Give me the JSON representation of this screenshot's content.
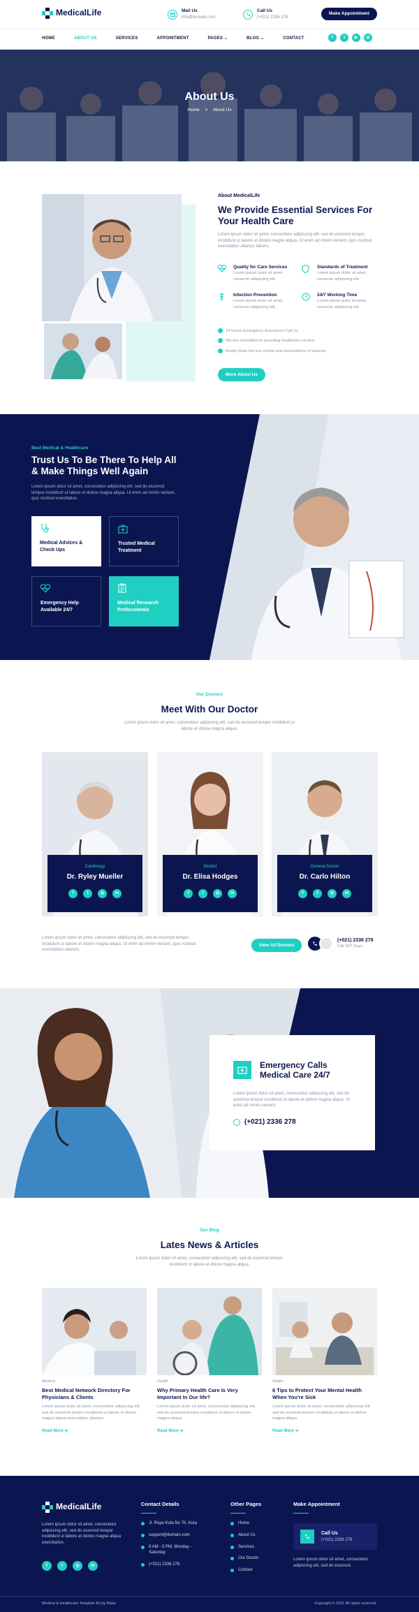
{
  "brand": {
    "name": "MedicalLife",
    "teal": "#1fcfc1",
    "navy": "#0b1650"
  },
  "header": {
    "mail_label": "Mail Us",
    "mail_value": "info@domain.com",
    "call_label": "Call Us",
    "call_value": "(+021) 2336 278",
    "cta": "Make Appointment",
    "nav": [
      "HOME",
      "ABOUT US",
      "SERVICES",
      "APPOINTMENT",
      "PAGES",
      "BLOG",
      "CONTACT"
    ],
    "social_icons": [
      "facebook-icon",
      "twitter-icon",
      "youtube-icon",
      "instagram-icon"
    ]
  },
  "hero": {
    "title": "About Us",
    "crumb_home": "Home",
    "crumb_sep": ">",
    "crumb_current": "About Us"
  },
  "about": {
    "eyebrow": "About MedicalLife",
    "title": "We Provide Essential Services For Your Health Care",
    "text": "Lorem ipsum dolor sit amet, consectetur adipiscing elit, sed do eiusmod tempor incididunt ut labore et dolore magna aliqua. Ut enim ad minim veniam, quis nostrud exercitation ullamco laboris.",
    "features": [
      {
        "title": "Quality for Care Services",
        "text": "Lorem ipsum dolor sit amet, consecte adipiscing elit."
      },
      {
        "title": "Standards of Treatment",
        "text": "Lorem ipsum dolor sit amet, consecte adipiscing elit."
      },
      {
        "title": "Infection Prevention",
        "text": "Lorem ipsum dolor sit amet, consecte adipiscing elit."
      },
      {
        "title": "24/7 Working Time",
        "text": "Lorem ipsum dolor sit amet, consecte adipiscing elit."
      }
    ],
    "checks": [
      "24 Hours Emergency Assistance Call Us",
      "We are committed to providing healthcare service",
      "Really know the true needs and expectations of patients"
    ],
    "cta": "More About Us"
  },
  "trust": {
    "eyebrow": "Best Medical & Healthcare",
    "title": "Trust Us To Be There To Help All & Make Things Well Again",
    "text": "Lorem ipsum dolor sit amet, consectetur adipiscing elit, sed do eiusmod tempor incididunt ut labore et dolore magna aliqua. Ut enim ad minim veniam, quis nostrud exercitation.",
    "services": [
      "Medical Advices & Check Ups",
      "Trusted Medical Treatment",
      "Emergency Help Available 24/7",
      "Medical Research Professionals"
    ]
  },
  "doctors": {
    "eyebrow": "Our Doctors",
    "title": "Meet With Our Doctor",
    "text": "Lorem ipsum dolor sit amet, consectetur adipiscing elit, sed do eiusmod tempor incididunt ut labore et dolore magna aliqua.",
    "list": [
      {
        "role": "Cardiology",
        "name": "Dr. Ryley Mueller"
      },
      {
        "role": "Dentist",
        "name": "Dr. Elisa Hodges"
      },
      {
        "role": "General Doctor",
        "name": "Dr. Carlo Hilton"
      }
    ],
    "bottom_text": "Lorem ipsum dolor sit amet, consectetur adipiscing elit, sed do eiusmod tempor incididunt ut labore et dolore magna aliqua. Ut enim ad minim veniam, quis nostrud exercitation ullamco.",
    "cta": "View All Doctors",
    "phone": "(+021) 2336 278",
    "phone_note": "Call 24/7 Days"
  },
  "emergency": {
    "title": "Emergency Calls Medical Care 24/7",
    "text": "Lorem ipsum dolor sit amet, consectetur adipiscing elit, sed do eiusmod tempor incididunt ut labore et dolore magna aliqua. Ut enim ad minim veniam.",
    "phone": "(+021) 2336 278"
  },
  "blog": {
    "eyebrow": "Our Blog",
    "title": "Lates News & Articles",
    "text": "Lorem ipsum dolor sit amet, consectetur adipiscing elit, sed do eiusmod tempor incididunt ut labore et dolore magna aliqua.",
    "posts": [
      {
        "cat": "Medical",
        "title": "Best Medical Network Directory For Physicians & Clients",
        "excerpt": "Lorem ipsum dolor sit amet, consectetur adipiscing elit, sed do eiusmod tempor incididunt ut labore et dolore magna aliqua exercitation ullamco.",
        "more": "Read More"
      },
      {
        "cat": "Health",
        "title": "Why Primary Health Care Is Very Important In Our life?",
        "excerpt": "Lorem ipsum dolor sit amet, consectetur adipiscing elit, sed do eiusmod tempor incididunt ut labore et dolore magna aliqua.",
        "more": "Read More"
      },
      {
        "cat": "Health",
        "title": "6 Tips to Protect Your Mental Health When You're Sick",
        "excerpt": "Lorem ipsum dolor sit amet, consectetur adipiscing elit, sed do eiusmod tempor incididunt ut labore et dolore magna aliqua.",
        "more": "Read More"
      }
    ]
  },
  "footer": {
    "about": "Lorem ipsum dolor sit amet, consectetur adipiscing elit, sed do eiusmod tempor incididunt ut labore et dolore magna aliqua exercitation.",
    "contact_title": "Contact Details",
    "contact": [
      "Jl. Raya Kuta No 70, Kuta",
      "support@domain.com",
      "8 AM - 5 PM, Monday - Saturday",
      "(+021) 2336 278"
    ],
    "pages_title": "Other Pages",
    "pages": [
      "Home",
      "About Us",
      "Services",
      "Our Doctor",
      "Contact"
    ],
    "appt_title": "Make Appointment",
    "appt_label": "Call Us",
    "appt_phone": "(+021) 2336 278",
    "appt_text": "Lorem ipsum dolor sit amet, consectetur adipiscing elit, sed do eiusmod.",
    "copy_left": "Medical & Healthcare Template Kit by Bakiz",
    "copy_right": "Copyright © 2021 All rights reserved."
  }
}
